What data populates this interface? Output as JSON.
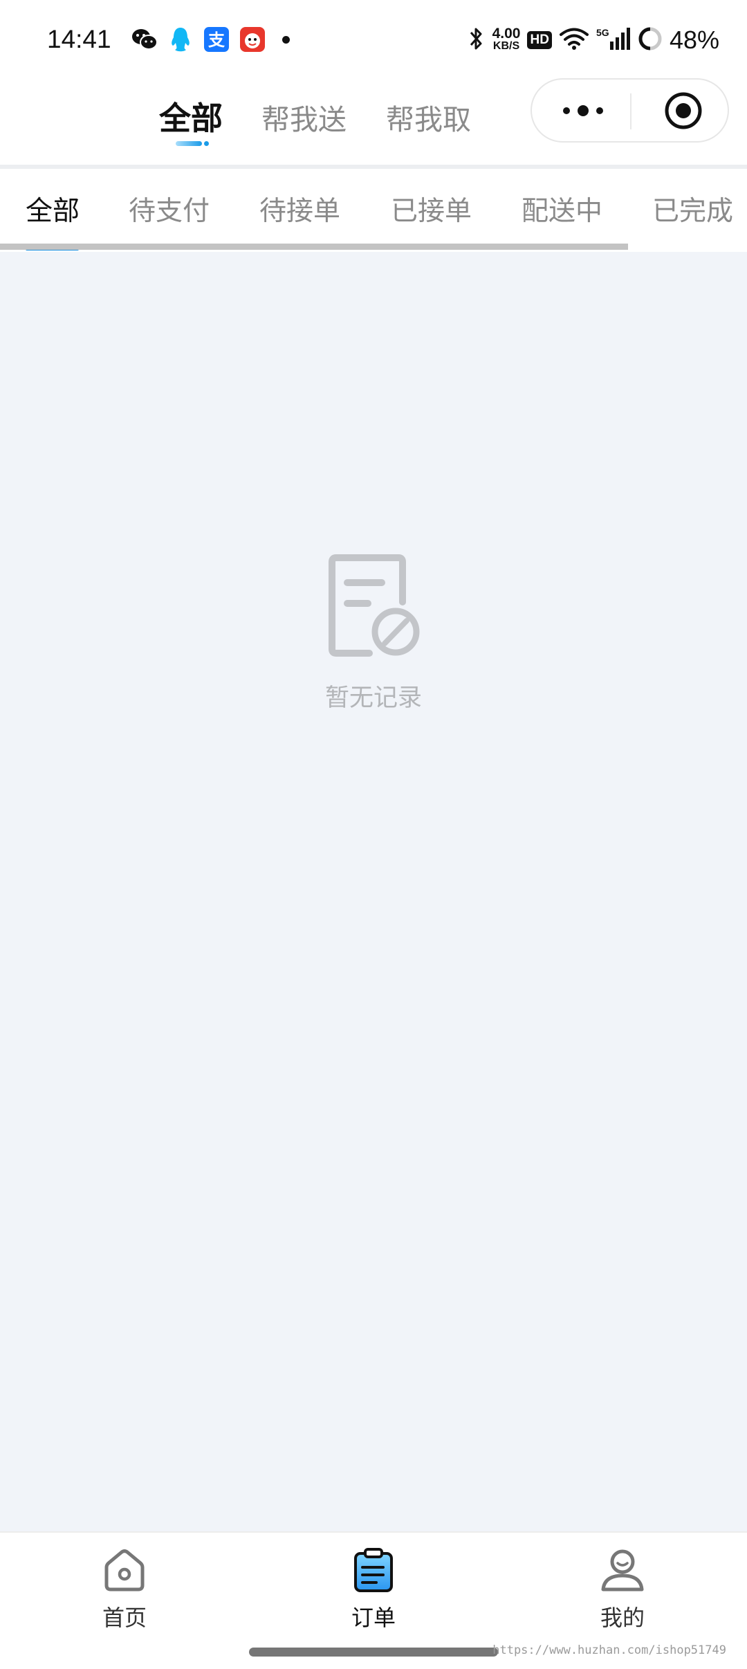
{
  "status_bar": {
    "time": "14:41",
    "net_speed_value": "4.00",
    "net_speed_unit": "KB/S",
    "hd_badge": "HD",
    "network_label": "5G",
    "battery": "48%"
  },
  "header": {
    "tabs": [
      {
        "label": "全部",
        "active": true
      },
      {
        "label": "帮我送",
        "active": false
      },
      {
        "label": "帮我取",
        "active": false
      }
    ],
    "accent_color": "#1a9be8"
  },
  "filters": {
    "tabs": [
      {
        "label": "全部",
        "active": true
      },
      {
        "label": "待支付",
        "active": false
      },
      {
        "label": "待接单",
        "active": false
      },
      {
        "label": "已接单",
        "active": false
      },
      {
        "label": "配送中",
        "active": false
      },
      {
        "label": "已完成",
        "active": false
      }
    ]
  },
  "empty_state": {
    "icon": "empty-record-icon",
    "text": "暂无记录"
  },
  "bottom_nav": {
    "items": [
      {
        "label": "首页",
        "icon": "home-icon",
        "active": false
      },
      {
        "label": "订单",
        "icon": "order-icon",
        "active": true
      },
      {
        "label": "我的",
        "icon": "profile-icon",
        "active": false
      }
    ]
  },
  "watermark": "https://www.huzhan.com/ishop51749"
}
